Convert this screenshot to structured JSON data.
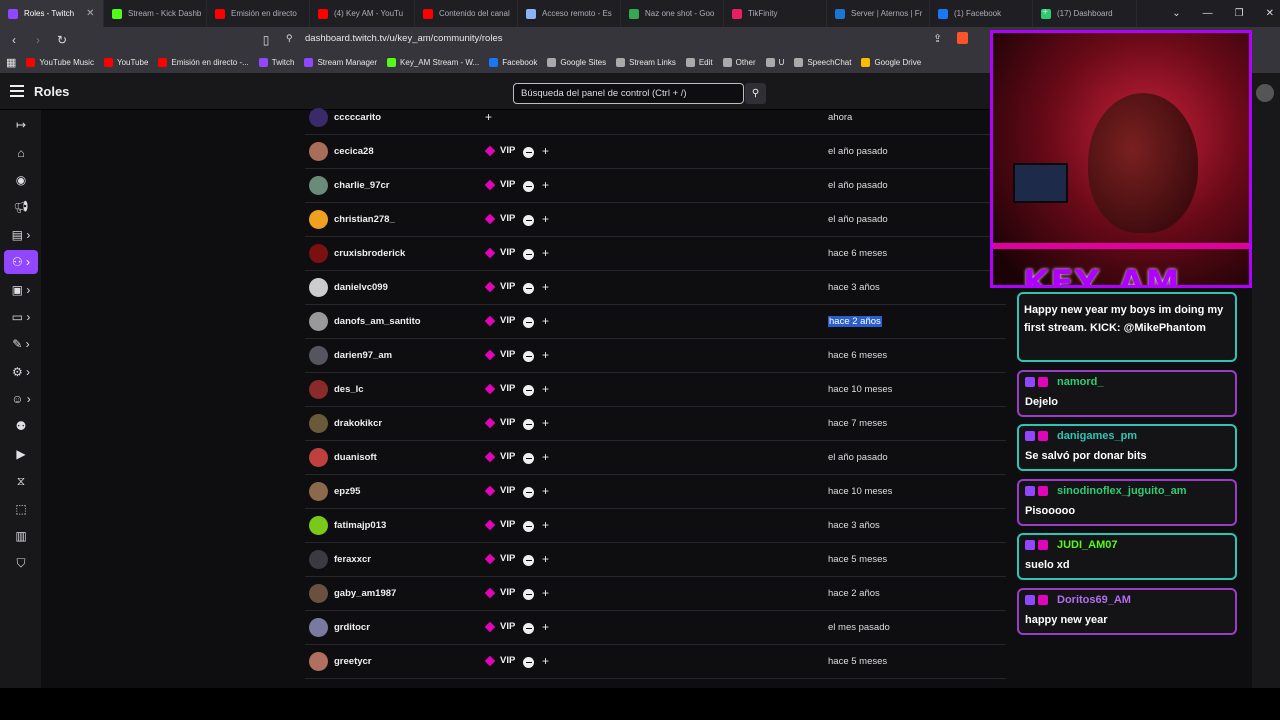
{
  "browser": {
    "tabs": [
      {
        "label": "Roles - Twitch",
        "color": "#9147ff"
      },
      {
        "label": "Stream - Kick Dashb",
        "color": "#53fc18"
      },
      {
        "label": "Emisión en directo",
        "color": "#ff0000"
      },
      {
        "label": "(4) Key AM - YouTu",
        "color": "#ff0000"
      },
      {
        "label": "Contenido del canal",
        "color": "#ff0000"
      },
      {
        "label": "Acceso remoto - Es",
        "color": "#8ab4f8"
      },
      {
        "label": "Naz one shot - Goo",
        "color": "#34a853"
      },
      {
        "label": "TikFinity",
        "color": "#e91e63"
      },
      {
        "label": "Server | Aternos | Fr",
        "color": "#1976d2"
      },
      {
        "label": "(1) Facebook",
        "color": "#1877f2"
      },
      {
        "label": "(17) Dashboard",
        "color": "#2ecc71"
      }
    ],
    "url": "dashboard.twitch.tv/u/key_am/community/roles",
    "bookmarks": [
      {
        "label": "YouTube Music",
        "color": "#ff0000"
      },
      {
        "label": "YouTube",
        "color": "#ff0000"
      },
      {
        "label": "Emisión en directo -...",
        "color": "#ff0000"
      },
      {
        "label": "Twitch",
        "color": "#9147ff"
      },
      {
        "label": "Stream Manager",
        "color": "#9147ff"
      },
      {
        "label": "Key_AM Stream - W...",
        "color": "#53fc18"
      },
      {
        "label": "Facebook",
        "color": "#1877f2"
      },
      {
        "label": "Google Sites",
        "color": "#aaaaaa"
      },
      {
        "label": "Stream Links",
        "color": "#aaaaaa"
      },
      {
        "label": "Edit",
        "color": "#aaaaaa"
      },
      {
        "label": "Other",
        "color": "#aaaaaa"
      },
      {
        "label": "U",
        "color": "#aaaaaa"
      },
      {
        "label": "SpeechChat",
        "color": "#aaaaaa"
      },
      {
        "label": "Google Drive",
        "color": "#fbbc04"
      }
    ]
  },
  "header": {
    "title": "Roles",
    "search_placeholder": "Búsqueda del panel de control (Ctrl + /)"
  },
  "roles": {
    "vip_label": "VIP",
    "rows": [
      {
        "user": "cccccarito",
        "vip": false,
        "date": "ahora",
        "avatar": "#3a2a6a"
      },
      {
        "user": "cecica28",
        "vip": true,
        "date": "el año pasado",
        "avatar": "#a86e5a"
      },
      {
        "user": "charlie_97cr",
        "vip": true,
        "date": "el año pasado",
        "avatar": "#6a8a7a"
      },
      {
        "user": "christian278_",
        "vip": true,
        "date": "el año pasado",
        "avatar": "#f0a020"
      },
      {
        "user": "cruxisbroderick",
        "vip": true,
        "date": "hace 6 meses",
        "avatar": "#7a1010"
      },
      {
        "user": "danielvc099",
        "vip": true,
        "date": "hace 3 años",
        "avatar": "#cccccc"
      },
      {
        "user": "danofs_am_santito",
        "vip": true,
        "date": "hace 2 años",
        "avatar": "#999999",
        "highlight": true
      },
      {
        "user": "darien97_am",
        "vip": true,
        "date": "hace 6 meses",
        "avatar": "#555560"
      },
      {
        "user": "des_lc",
        "vip": true,
        "date": "hace 10 meses",
        "avatar": "#8a2a2a"
      },
      {
        "user": "drakokikcr",
        "vip": true,
        "date": "hace 7 meses",
        "avatar": "#6a5a3a"
      },
      {
        "user": "duanisoft",
        "vip": true,
        "date": "el año pasado",
        "avatar": "#c04040"
      },
      {
        "user": "epz95",
        "vip": true,
        "date": "hace 10 meses",
        "avatar": "#8a6a4a"
      },
      {
        "user": "fatimajp013",
        "vip": true,
        "date": "hace 3 años",
        "avatar": "#7ac81a"
      },
      {
        "user": "feraxxcr",
        "vip": true,
        "date": "hace 5 meses",
        "avatar": "#3a3a40"
      },
      {
        "user": "gaby_am1987",
        "vip": true,
        "date": "hace 2 años",
        "avatar": "#6a5040"
      },
      {
        "user": "grditocr",
        "vip": true,
        "date": "el mes pasado",
        "avatar": "#7a7aa0"
      },
      {
        "user": "greetycr",
        "vip": true,
        "date": "hace 5 meses",
        "avatar": "#b07060"
      }
    ]
  },
  "overlay": {
    "logo_text": "KEY_AM",
    "first_message": "Happy new year my boys im doing my first stream. KICK: @MikePhantom",
    "chat": [
      {
        "user": "namord_",
        "color": "#2ecc71",
        "text": "Dejelo",
        "style": "pk"
      },
      {
        "user": "danigames_pm",
        "color": "#2ec4b6",
        "text": "Se salvó por donar bits",
        "style": "tl"
      },
      {
        "user": "sinodinoflex_juguito_am",
        "color": "#2ecc71",
        "text": "Pisooooo",
        "style": "pk"
      },
      {
        "user": "JUDI_AM07",
        "color": "#53fc18",
        "text": "suelo xd",
        "style": "tl"
      },
      {
        "user": "Doritos69_AM",
        "color": "#b56cf0",
        "text": "happy new year",
        "style": "pk"
      }
    ]
  }
}
